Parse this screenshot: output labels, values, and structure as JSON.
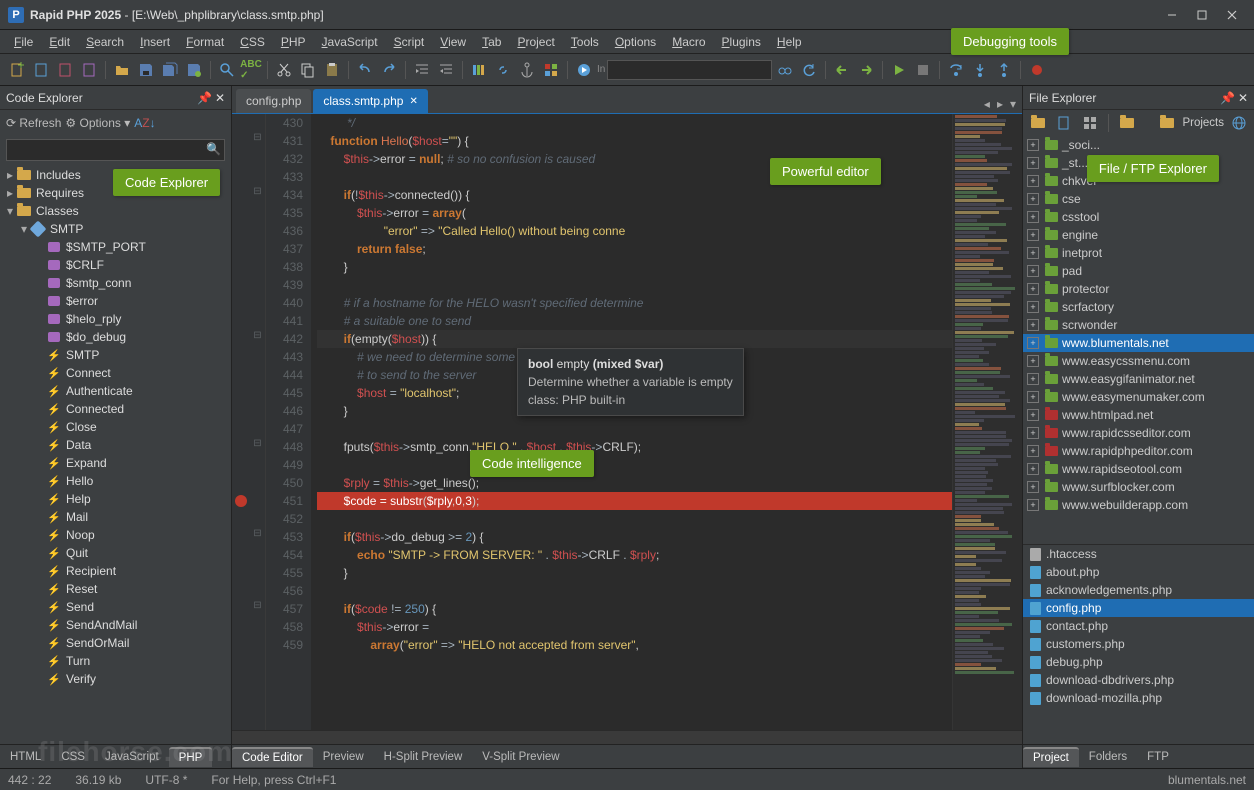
{
  "title": {
    "app": "Rapid PHP 2025",
    "path": "[E:\\Web\\_phplibrary\\class.smtp.php]"
  },
  "menus": [
    "File",
    "Edit",
    "Search",
    "Insert",
    "Format",
    "CSS",
    "PHP",
    "JavaScript",
    "Script",
    "View",
    "Tab",
    "Project",
    "Tools",
    "Options",
    "Macro",
    "Plugins",
    "Help"
  ],
  "callouts": {
    "debugging": "Debugging tools",
    "powerful": "Powerful editor",
    "explorer_left": "Code Explorer",
    "intelligence": "Code intelligence",
    "file_ftp": "File / FTP Explorer"
  },
  "left": {
    "title": "Code Explorer",
    "refresh": "Refresh",
    "options": "Options",
    "search_placeholder": "",
    "folders": [
      "Includes",
      "Requires",
      "Classes"
    ],
    "class_name": "SMTP",
    "props": [
      "$SMTP_PORT",
      "$CRLF",
      "$smtp_conn",
      "$error",
      "$helo_rply",
      "$do_debug"
    ],
    "methods": [
      "SMTP",
      "Connect",
      "Authenticate",
      "Connected",
      "Close",
      "Data",
      "Expand",
      "Hello",
      "Help",
      "Mail",
      "Noop",
      "Quit",
      "Recipient",
      "Reset",
      "Send",
      "SendAndMail",
      "SendOrMail",
      "Turn",
      "Verify"
    ],
    "lang_tabs": [
      "HTML",
      "CSS",
      "JavaScript",
      "PHP"
    ],
    "lang_active": "PHP"
  },
  "editor": {
    "tabs": [
      {
        "label": "config.php",
        "active": false
      },
      {
        "label": "class.smtp.php",
        "active": true
      }
    ],
    "first_line": 430,
    "lines": [
      {
        "n": 430,
        "html": "         <span class='c-com'>*/</span>"
      },
      {
        "n": 431,
        "html": "    <span class='c-kw2'>function</span> <span class='c-fn'>Hello</span>(<span class='c-var'>$host</span><span class='c-op'>=</span><span class='c-str'>\"\"</span>) {"
      },
      {
        "n": 432,
        "html": "        <span class='c-var'>$this</span><span class='c-op'>-&gt;</span><span class='c-txt'>error</span> <span class='c-op'>=</span> <span class='c-kw2'>null</span>; <span class='c-com'># so no confusion is caused</span>"
      },
      {
        "n": 433,
        "html": ""
      },
      {
        "n": 434,
        "html": "        <span class='c-kw2'>if</span>(<span class='c-op'>!</span><span class='c-var'>$this</span><span class='c-op'>-&gt;</span><span class='c-txt'>connected</span>()) {"
      },
      {
        "n": 435,
        "html": "            <span class='c-var'>$this</span><span class='c-op'>-&gt;</span><span class='c-txt'>error</span> <span class='c-op'>=</span> <span class='c-kw2'>array</span>("
      },
      {
        "n": 436,
        "html": "                    <span class='c-str'>\"error\"</span> <span class='c-op'>=&gt;</span> <span class='c-str'>\"Called Hello() without being conne</span>"
      },
      {
        "n": 437,
        "html": "            <span class='c-kw2'>return</span> <span class='c-kw2'>false</span>;"
      },
      {
        "n": 438,
        "html": "        }"
      },
      {
        "n": 439,
        "html": ""
      },
      {
        "n": 440,
        "html": "        <span class='c-com'># if a hostname for the HELO wasn't specified determine</span>"
      },
      {
        "n": 441,
        "html": "        <span class='c-com'># a suitable one to send</span>"
      },
      {
        "n": 442,
        "html": "        <span class='c-kw2'>if</span>(<span class='c-txt'>empty</span>(<span class='c-var'>$host</span>)) {",
        "cur": true
      },
      {
        "n": 443,
        "html": "            <span class='c-com'># we need to determine some sort of appopiate default</span>"
      },
      {
        "n": 444,
        "html": "            <span class='c-com'># to send to the server</span>"
      },
      {
        "n": 445,
        "html": "            <span class='c-var'>$host</span> <span class='c-op'>=</span> <span class='c-str'>\"localhost\"</span>;"
      },
      {
        "n": 446,
        "html": "        }"
      },
      {
        "n": 447,
        "html": ""
      },
      {
        "n": 448,
        "html": "        <span class='c-txt'>fputs</span>(<span class='c-var'>$this</span><span class='c-op'>-&gt;</span><span class='c-txt'>smtp_conn</span>,<span class='c-str'>\"HELO \"</span> <span class='c-op'>.</span> <span class='c-var'>$host</span> <span class='c-op'>.</span> <span class='c-var'>$this</span><span class='c-op'>-&gt;</span><span class='c-txt'>CRLF</span>);"
      },
      {
        "n": 449,
        "html": ""
      },
      {
        "n": 450,
        "html": "        <span class='c-var'>$rply</span> <span class='c-op'>=</span> <span class='c-var'>$this</span><span class='c-op'>-&gt;</span><span class='c-txt'>get_lines</span>();"
      },
      {
        "n": 451,
        "html": "        <span class='c-var' style='color:#fff'>$code</span> <span class='c-op' style='color:#fff'>=</span> <span class='c-txt' style='color:#fff'>substr</span>(<span class='c-var' style='color:#fff'>$rply</span>,<span class='c-num' style='color:#fff'>0</span>,<span class='c-num' style='color:#fff'>3</span>);",
        "bp": true
      },
      {
        "n": 452,
        "html": ""
      },
      {
        "n": 453,
        "html": "        <span class='c-kw2'>if</span>(<span class='c-var'>$this</span><span class='c-op'>-&gt;</span><span class='c-txt'>do_debug</span> <span class='c-op'>&gt;=</span> <span class='c-num'>2</span>) {"
      },
      {
        "n": 454,
        "html": "            <span class='c-kw2'>echo</span> <span class='c-str'>\"SMTP -&gt; FROM SERVER: \"</span> <span class='c-op'>.</span> <span class='c-var'>$this</span><span class='c-op'>-&gt;</span><span class='c-txt'>CRLF</span> <span class='c-op'>.</span> <span class='c-var'>$rply</span>;"
      },
      {
        "n": 455,
        "html": "        }"
      },
      {
        "n": 456,
        "html": ""
      },
      {
        "n": 457,
        "html": "        <span class='c-kw2'>if</span>(<span class='c-var'>$code</span> <span class='c-op'>!=</span> <span class='c-num'>250</span>) {"
      },
      {
        "n": 458,
        "html": "            <span class='c-var'>$this</span><span class='c-op'>-&gt;</span><span class='c-txt'>error</span> <span class='c-op'>=</span>"
      },
      {
        "n": 459,
        "html": "                <span class='c-kw2'>array</span>(<span class='c-str'>\"error\"</span> <span class='c-op'>=&gt;</span> <span class='c-str'>\"HELO not accepted from server\"</span>,"
      }
    ],
    "tooltip": {
      "sig": "bool empty (mixed $var)",
      "desc": "Determine whether a variable is empty",
      "cls": "class: PHP built-in"
    },
    "bottom_tabs": [
      "Code Editor",
      "Preview",
      "H-Split Preview",
      "V-Split Preview"
    ],
    "bottom_active": "Code Editor"
  },
  "right": {
    "title": "File Explorer",
    "projects_label": "Projects",
    "folders": [
      {
        "label": "_soci...",
        "color": "green"
      },
      {
        "label": "_st...",
        "color": "green"
      },
      {
        "label": "chkver",
        "color": "green"
      },
      {
        "label": "cse",
        "color": "green"
      },
      {
        "label": "csstool",
        "color": "green"
      },
      {
        "label": "engine",
        "color": "green"
      },
      {
        "label": "inetprot",
        "color": "green"
      },
      {
        "label": "pad",
        "color": "green"
      },
      {
        "label": "protector",
        "color": "green"
      },
      {
        "label": "scrfactory",
        "color": "green"
      },
      {
        "label": "scrwonder",
        "color": "green"
      },
      {
        "label": "www.blumentals.net",
        "color": "green",
        "selected": true
      },
      {
        "label": "www.easycssmenu.com",
        "color": "green"
      },
      {
        "label": "www.easygifanimator.net",
        "color": "green"
      },
      {
        "label": "www.easymenumaker.com",
        "color": "green"
      },
      {
        "label": "www.htmlpad.net",
        "color": "red"
      },
      {
        "label": "www.rapidcsseditor.com",
        "color": "red"
      },
      {
        "label": "www.rapidphpeditor.com",
        "color": "red"
      },
      {
        "label": "www.rapidseotool.com",
        "color": "green"
      },
      {
        "label": "www.surfblocker.com",
        "color": "green"
      },
      {
        "label": "www.webuilderapp.com",
        "color": "green"
      }
    ],
    "files": [
      {
        "label": ".htaccess",
        "php": false
      },
      {
        "label": "about.php",
        "php": true
      },
      {
        "label": "acknowledgements.php",
        "php": true
      },
      {
        "label": "config.php",
        "php": true,
        "selected": true
      },
      {
        "label": "contact.php",
        "php": true
      },
      {
        "label": "customers.php",
        "php": true
      },
      {
        "label": "debug.php",
        "php": true
      },
      {
        "label": "download-dbdrivers.php",
        "php": true
      },
      {
        "label": "download-mozilla.php",
        "php": true
      }
    ],
    "bottom_tabs": [
      "Project",
      "Folders",
      "FTP"
    ],
    "bottom_active": "Project"
  },
  "status": {
    "pos": "442 : 22",
    "size": "36.19 kb",
    "enc": "UTF-8 *",
    "hint": "For Help, press Ctrl+F1",
    "site": "blumentals.net"
  },
  "watermark": "filehorse.com"
}
